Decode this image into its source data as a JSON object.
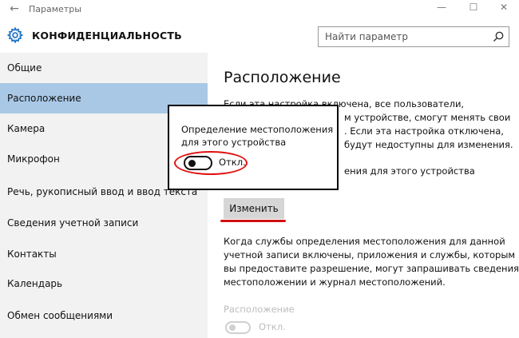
{
  "window": {
    "title": "Параметры",
    "back_glyph": "←",
    "minimize_glyph": "—",
    "maximize_glyph": "☐",
    "close_glyph": "✕"
  },
  "header": {
    "app_title": "КОНФИДЕНЦИАЛЬНОСТЬ",
    "icon": "gear-icon"
  },
  "search": {
    "placeholder": "Найти параметр",
    "icon": "search-icon"
  },
  "sidebar": {
    "selected_index": 1,
    "items": [
      {
        "label": "Общие"
      },
      {
        "label": "Расположение"
      },
      {
        "label": "Камера"
      },
      {
        "label": "Микрофон"
      },
      {
        "label": "Речь, рукописный ввод и ввод текста"
      },
      {
        "label": "Сведения учетной записи"
      },
      {
        "label": "Контакты"
      },
      {
        "label": "Календарь"
      },
      {
        "label": "Обмен сообщениями"
      }
    ]
  },
  "main": {
    "title": "Расположение",
    "para1_lines": [
      "Если эта настройка включена, все пользователи,",
      "м устройстве, смогут менять свои",
      ". Если эта настройка отключена,",
      "будут недоступны для изменения."
    ],
    "device_status": "ения для этого устройства",
    "change_button": "Изменить",
    "para2_lines": [
      "Когда службы определения местоположения для данной",
      "учетной записи включены, приложения и службы, которым",
      "вы предоставите разрешение, могут запрашивать сведения о",
      "местоположении и журнал местоположений."
    ],
    "location_toggle": {
      "label": "Расположение",
      "state_label": "Откл."
    }
  },
  "popup": {
    "title_lines": [
      "Определение местоположения",
      "для этого устройства"
    ],
    "toggle_state_label": "Откл."
  },
  "colors": {
    "selected_nav": "#a9c8e6",
    "sidebar_bg": "#f2f2f2",
    "highlight": "#e01010"
  }
}
